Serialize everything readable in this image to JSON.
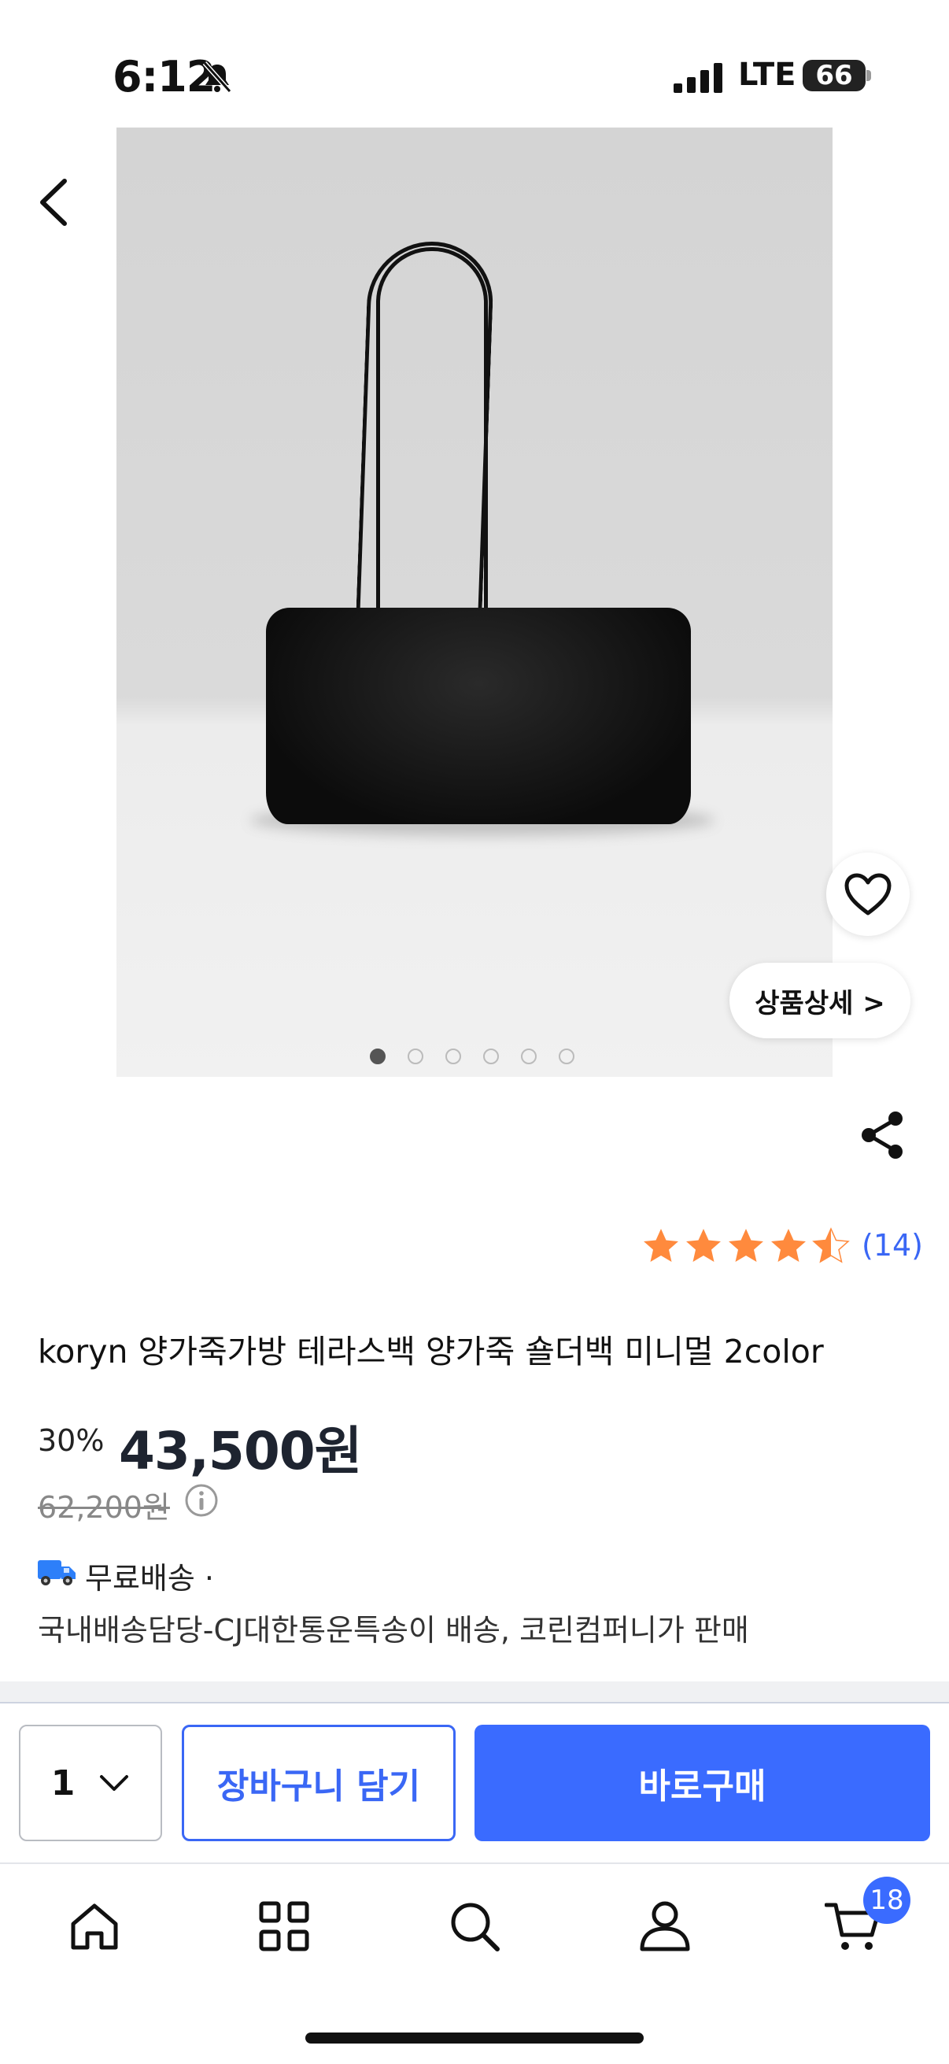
{
  "status_bar": {
    "time": "6:12",
    "network": "LTE",
    "battery": "66"
  },
  "gallery": {
    "dots": [
      true,
      false,
      false,
      false,
      false,
      false
    ]
  },
  "detail_button_label": "상품상세 >",
  "rating": {
    "stars": 4.5,
    "count": "(14)"
  },
  "product": {
    "title": "koryn 양가죽가방 테라스백 양가죽 숄더백 미니멀 2color",
    "discount": "30%",
    "price": "43,500원",
    "original_price": "62,200원"
  },
  "shipping": {
    "label": "무료배송 ·",
    "description": "국내배송담당-CJ대한통운특송이 배송, 코린컴퍼니가 판매"
  },
  "actions": {
    "quantity": "1",
    "cart_label": "장바구니 담기",
    "buy_label": "바로구매"
  },
  "tabbar": {
    "cart_badge": "18"
  },
  "colors": {
    "accent": "#3a6bff",
    "star": "#ff8a3d",
    "price": "#1e2430"
  }
}
